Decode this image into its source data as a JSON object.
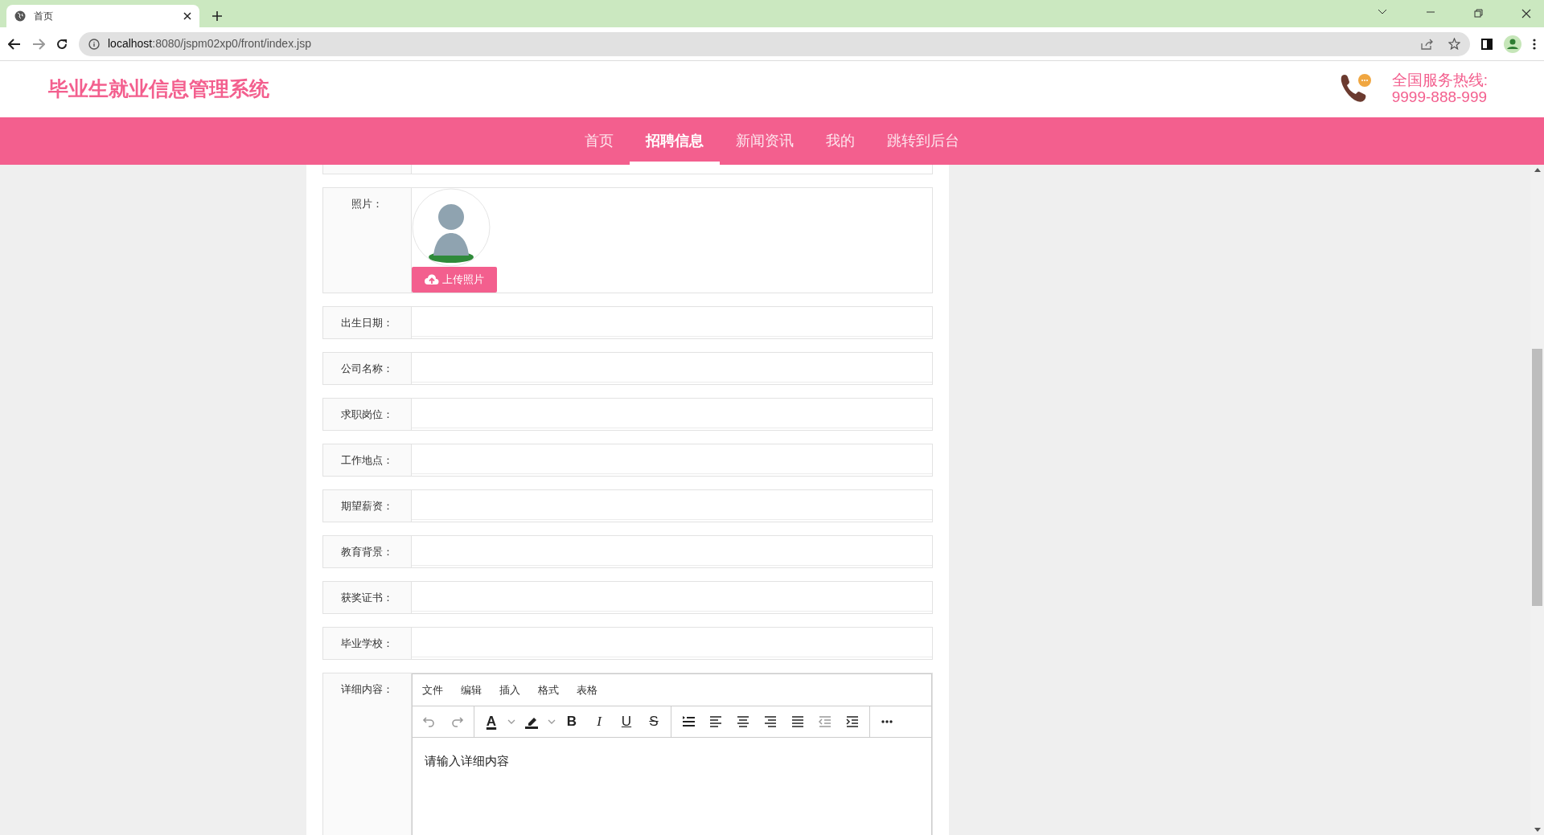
{
  "browser": {
    "tab_title": "首页",
    "url_host": "localhost",
    "url_rest": ":8080/jspm02xp0/front/index.jsp"
  },
  "header": {
    "title": "毕业生就业信息管理系统",
    "hotline_label": "全国服务热线:",
    "hotline": "9999-888-999"
  },
  "nav": [
    {
      "label": "首页",
      "selected": false
    },
    {
      "label": "招聘信息",
      "selected": true
    },
    {
      "label": "新闻资讯",
      "selected": false
    },
    {
      "label": "我的",
      "selected": false
    },
    {
      "label": "跳转到后台",
      "selected": false
    }
  ],
  "photo": {
    "label": "照片：",
    "button": "上传照片"
  },
  "fields": [
    {
      "label": "出生日期："
    },
    {
      "label": "公司名称："
    },
    {
      "label": "求职岗位："
    },
    {
      "label": "工作地点："
    },
    {
      "label": "期望薪资："
    },
    {
      "label": "教育背景："
    },
    {
      "label": "获奖证书："
    },
    {
      "label": "毕业学校："
    }
  ],
  "editor": {
    "label": "详细内容：",
    "menus": [
      "文件",
      "编辑",
      "插入",
      "格式",
      "表格"
    ],
    "toolbar": [
      [
        {
          "kind": "undo"
        },
        {
          "kind": "redo"
        }
      ],
      [
        {
          "kind": "color",
          "text": "A"
        },
        {
          "kind": "caret"
        },
        {
          "kind": "highlight"
        },
        {
          "kind": "caret"
        },
        {
          "kind": "bold",
          "text": "B"
        },
        {
          "kind": "italic",
          "text": "I"
        },
        {
          "kind": "underline",
          "text": "U"
        },
        {
          "kind": "strike",
          "text": "S"
        }
      ],
      [
        {
          "kind": "line-height"
        },
        {
          "kind": "align-left"
        },
        {
          "kind": "align-center"
        },
        {
          "kind": "align-right"
        },
        {
          "kind": "justify"
        },
        {
          "kind": "outdent"
        },
        {
          "kind": "indent"
        }
      ],
      [
        {
          "kind": "more"
        }
      ]
    ],
    "placeholder": "请输入详细内容"
  }
}
